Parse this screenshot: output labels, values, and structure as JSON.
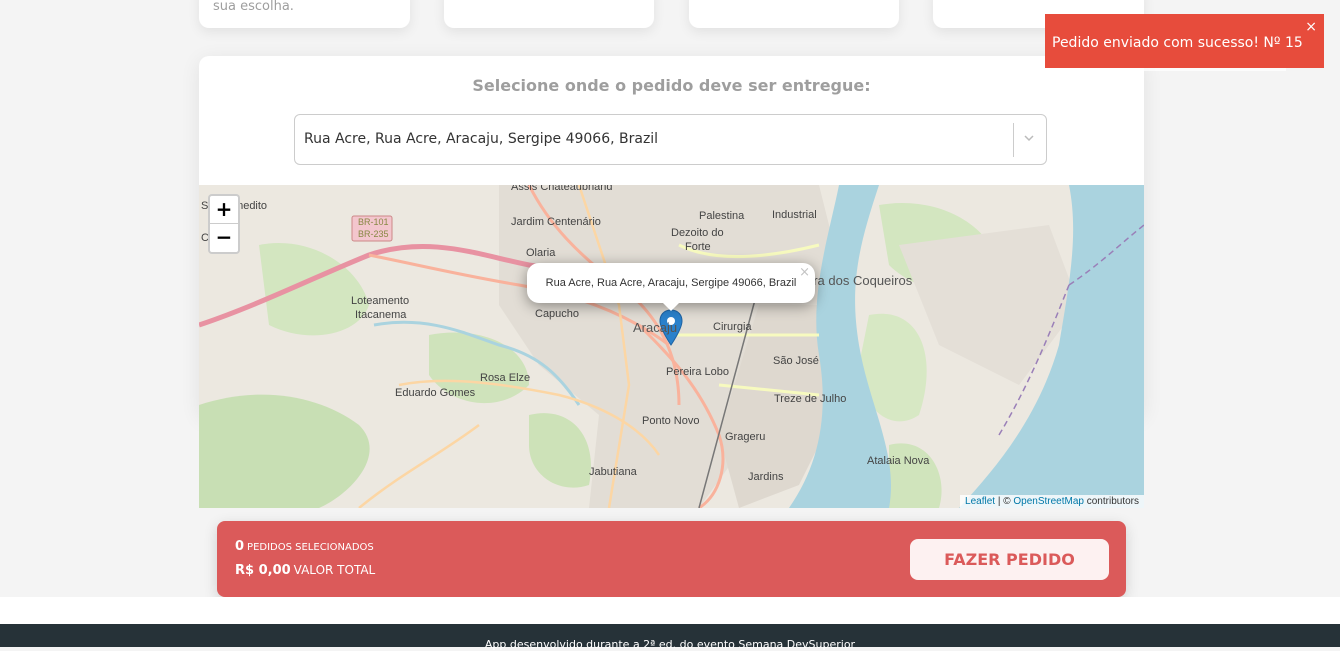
{
  "top_cards": {
    "first_text": "sua escolha."
  },
  "delivery": {
    "title": "Selecione onde o pedido deve ser entregue:",
    "selected_address": "Rua Acre, Rua Acre, Aracaju, Sergipe 49066, Brazil"
  },
  "map": {
    "zoom_in": "+",
    "zoom_out": "−",
    "popup_text": "Rua Acre, Rua Acre, Aracaju, Sergipe 49066, Brazil",
    "popup_close": "×",
    "attribution_leaflet": "Leaflet",
    "attribution_sep": " | © ",
    "attribution_osm": "OpenStreetMap",
    "attribution_suffix": " contributors",
    "labels": {
      "assis": "Assis Chateaubriand",
      "jardim_centenario": "Jardim Centenário",
      "palestina": "Palestina",
      "industrial": "Industrial",
      "dezoito": "Dezoito do",
      "forte": "Forte",
      "olaria": "Olaria",
      "barra": "Barra dos Coqueiros",
      "loteamento": "Loteamento",
      "itacanema": "Itacanema",
      "capucho": "Capucho",
      "aracaju": "Aracaju",
      "cirurgia": "Cirurgia",
      "sao_jose": "São José",
      "rosa_elze": "Rosa Elze",
      "eduardo_gomes": "Eduardo Gomes",
      "pereira_lobo": "Pereira Lobo",
      "treze": "Treze de Julho",
      "ponto_novo": "Ponto Novo",
      "grageru": "Grageru",
      "atalaia": "Atalaia Nova",
      "jabutiana": "Jabutiana",
      "jardins": "Jardins",
      "br101": "BR-101",
      "br235": "BR-235",
      "sedito": "São Benedito",
      "ara": "Carrá"
    }
  },
  "summary": {
    "count": "0",
    "count_label": "PEDIDOS SELECIONADOS",
    "total": "R$ 0,00",
    "total_label": "VALOR TOTAL",
    "button": "FAZER PEDIDO"
  },
  "footer": {
    "text": "App desenvolvido durante a 2ª ed. do evento Semana DevSuperior"
  },
  "toast": {
    "message": "Pedido enviado com sucesso! Nº 15",
    "close": "×"
  }
}
